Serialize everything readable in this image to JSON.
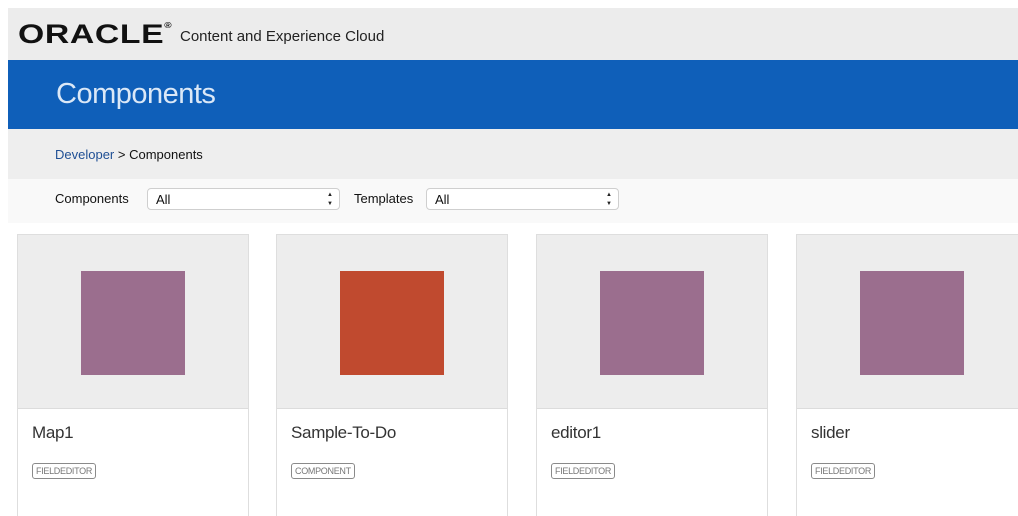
{
  "header": {
    "logo_text": "ORACLE",
    "logo_mark": "®",
    "app_name": "Content and Experience Cloud"
  },
  "banner": {
    "title": "Components"
  },
  "breadcrumb": {
    "link": "Developer",
    "separator": " > ",
    "current": "Components"
  },
  "filters": {
    "components_label": "Components",
    "components_value": "All",
    "templates_label": "Templates",
    "templates_value": "All",
    "arrow_up": "▲",
    "arrow_down": "▼"
  },
  "cards": [
    {
      "name": "Map1",
      "badge": "FIELDEDITOR",
      "color": "#9b6e8e"
    },
    {
      "name": "Sample-To-Do",
      "badge": "COMPONENT",
      "color": "#c04a2f"
    },
    {
      "name": "editor1",
      "badge": "FIELDEDITOR",
      "color": "#9b6e8e"
    },
    {
      "name": "slider",
      "badge": "FIELDEDITOR",
      "color": "#9b6e8e"
    }
  ]
}
